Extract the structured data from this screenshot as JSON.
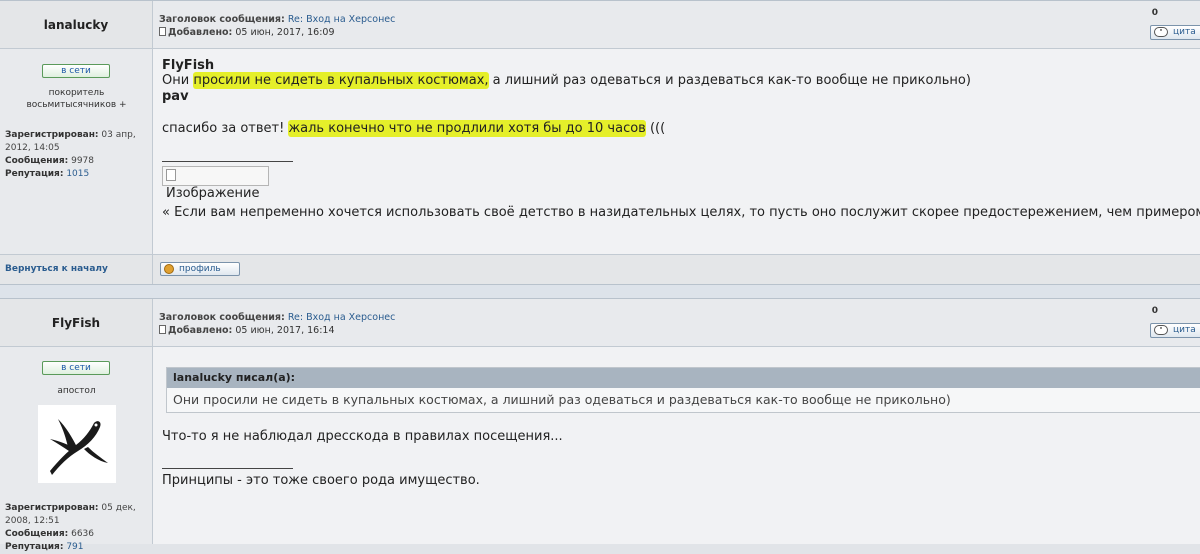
{
  "post1": {
    "username": "lanalucky",
    "subject_label": "Заголовок сообщения:",
    "subject_value": "Re: Вход на Херсонес",
    "added_label": "Добавлено:",
    "added_value": "05 июн, 2017, 16:09",
    "counter": "0",
    "quote_button": "цита",
    "status": "в сети",
    "rank": "покоритель восьмитысячников +",
    "registered_label": "Зарегистрирован:",
    "registered_value": "03 апр, 2012, 14:05",
    "messages_label": "Сообщения:",
    "messages_value": "9978",
    "reputation_label": "Репутация:",
    "reputation_value": "1015",
    "line1_name": "FlyFish",
    "line2_pre": "Они ",
    "line2_hl": "просили не сидеть в купальных костюмах,",
    "line2_post": " а лишний раз одеваться и раздеваться как-то вообще не прикольно)",
    "line3_name": "pav",
    "line4_pre": "спасибо за ответ! ",
    "line4_hl": "жаль конечно что не продлили хотя бы до 10 часов",
    "line4_post": " (((",
    "image_alt": "Изображение",
    "signature": "« Если вам непременно хочется использовать своё детство в назидательных целях, то пусть оно послужит скорее предостережением, чем примером. » (с)",
    "back_link": "Вернуться к началу",
    "profile_button": "профиль"
  },
  "post2": {
    "username": "FlyFish",
    "subject_label": "Заголовок сообщения:",
    "subject_value": "Re: Вход на Херсонес",
    "added_label": "Добавлено:",
    "added_value": "05 июн, 2017, 16:14",
    "counter": "0",
    "quote_button": "цита",
    "status": "в сети",
    "rank": "апостол",
    "quote_author": "lanalucky писал(а):",
    "quote_text": "Они просили не сидеть в купальных костюмах, а лишний раз одеваться и раздеваться как-то вообще не прикольно)",
    "body": "Что-то я не наблюдал дресскода в правилах посещения...",
    "signature": "Принципы - это тоже своего рода имущество.",
    "registered_label": "Зарегистрирован:",
    "registered_value": "05 дек, 2008, 12:51",
    "messages_label": "Сообщения:",
    "messages_value": "6636",
    "reputation_label": "Репутация:",
    "reputation_value": "791"
  }
}
